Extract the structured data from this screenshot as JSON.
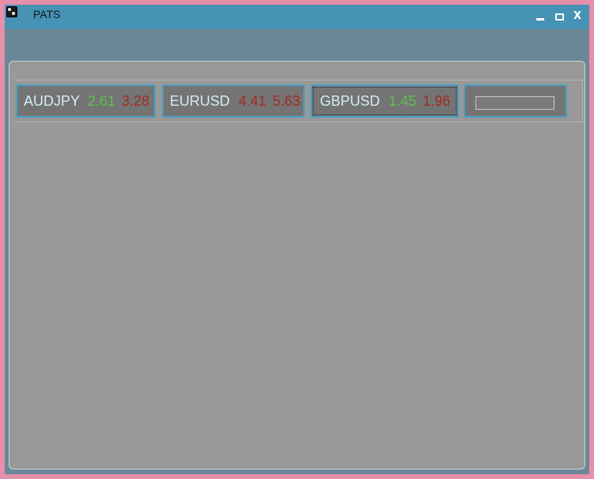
{
  "window": {
    "title": "PATS",
    "icon": "app-icon",
    "controls": {
      "minimize": "minimize-icon",
      "maximize": "maximize-icon",
      "close_label": "X"
    }
  },
  "tickers": [
    {
      "symbol": "AUDJPY",
      "bid": "2.61",
      "ask": "3.28",
      "bid_color": "#5cc24a",
      "ask_color": "#a32a22"
    },
    {
      "symbol": "EURUSD",
      "bid": "4.41",
      "ask": "5.63",
      "bid_color": "#a32a22",
      "ask_color": "#a32a22"
    },
    {
      "symbol": "GBPUSD",
      "bid": "1.45",
      "ask": "1.96",
      "bid_color": "#5cc24a",
      "ask_color": "#a32a22"
    }
  ],
  "new_ticker": {
    "value": "",
    "placeholder": ""
  },
  "colors": {
    "background": "#e58fab",
    "titlebar": "#4793b5",
    "window_body": "#6b8896",
    "panel": "#999999",
    "tile": "#747474",
    "tile_border": "#4aa0c4",
    "up": "#5cc24a",
    "down": "#a32a22"
  }
}
